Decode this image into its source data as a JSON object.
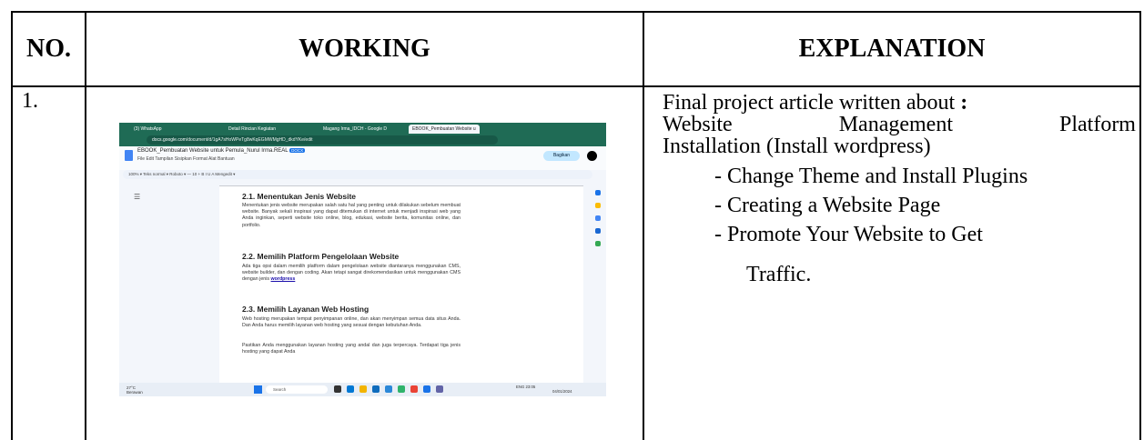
{
  "table": {
    "headers": {
      "no": "NO.",
      "working": "WORKING",
      "explanation": "EXPLANATION"
    },
    "row1": {
      "number": "1.",
      "explanation": {
        "line1": "Final project article written about",
        "colon": ":",
        "line2_words": [
          "Website",
          "Management",
          "Platform"
        ],
        "line3": "Installation (Install wordpress)",
        "items": [
          "- Change Theme and Install Plugins",
          "- Creating a Website Page",
          "- Promote Your Website to Get"
        ],
        "continuation": "Traffic."
      }
    }
  },
  "screenshot": {
    "tabs": [
      "(3) WhatsApp",
      "Detail Rincian Kegiatan",
      "Magang Irma_IDCH - Google D",
      "EBOOK_Pembuatan Website u"
    ],
    "url_domain": "docs.google.com",
    "url_path": "/document/d/1gA7sHoWPeTg8wKqEGMWMgHD_dkdYKe/edit",
    "doc_title": "EBOOK_Pembuatan Website untuk Pemula_Nurul Irma.REAL",
    "doc_badge": "DOCX",
    "menu": "File  Edit  Tampilan  Sisipkan  Format  Alat  Bantuan",
    "share_label": "Bagikan",
    "toolbar_text": "100%  ▾   Teks normal  ▾   Roboto  ▾   —  10  +    B  I  U  A       Mengedit  ▾",
    "sections": [
      {
        "heading": "2.1. Menentukan Jenis Website",
        "text": "Menentukan jenis website merupakan salah satu hal yang penting untuk dilakukan sebelum membuat website. Banyak sekali inspirasi yang dapat ditemukan di internet untuk menjadi inspirasi web yang Anda inginkan, seperti website toko online, blog, edukasi, website berita, komunitas online, dan portfolio."
      },
      {
        "heading": "2.2. Memilih Platform Pengelolaan Website",
        "text": "Ada tiga opsi dalam memilih platform dalam pengelolaan website diantaranya menggunakan CMS, website builder, dan dengan coding. Akan tetapi sangat direkomendasikan untuk menggunakan CMS dengan jenis",
        "link": "wordpress"
      },
      {
        "heading": "2.3. Memilih Layanan Web Hosting",
        "text": "Web hosting merupakan tempat penyimpanan online, dan akan menyimpan semua data situs Anda. Dan Anda harus memilih layanan web hosting yang sesuai dengan kebutuhan Anda.",
        "text2": "Pastikan Anda menggunakan layanan hosting yang andal dan juga terpercaya. Terdapat tiga jenis hosting yang dapat Anda"
      }
    ],
    "taskbar": {
      "weather_temp": "27°C",
      "weather_desc": "Berawan",
      "search_placeholder": "Search",
      "lang": "ENG",
      "time": "23:05",
      "date": "04/01/2024"
    }
  }
}
